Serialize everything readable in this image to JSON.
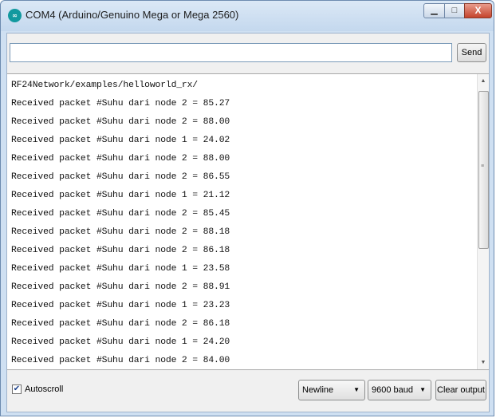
{
  "window": {
    "title": "COM4 (Arduino/Genuino Mega or Mega 2560)",
    "app_icon_text": "∞",
    "minimize_symbol": "▁",
    "maximize_symbol": "□",
    "close_symbol": "X"
  },
  "input": {
    "value": "",
    "send_label": "Send"
  },
  "output": {
    "lines": [
      "RF24Network/examples/helloworld_rx/",
      "Received packet #Suhu dari node 2 = 85.27",
      "Received packet #Suhu dari node 2 = 88.00",
      "Received packet #Suhu dari node 1 = 24.02",
      "Received packet #Suhu dari node 2 = 88.00",
      "Received packet #Suhu dari node 2 = 86.55",
      "Received packet #Suhu dari node 1 = 21.12",
      "Received packet #Suhu dari node 2 = 85.45",
      "Received packet #Suhu dari node 2 = 88.18",
      "Received packet #Suhu dari node 2 = 86.18",
      "Received packet #Suhu dari node 1 = 23.58",
      "Received packet #Suhu dari node 2 = 88.91",
      "Received packet #Suhu dari node 1 = 23.23",
      "Received packet #Suhu dari node 2 = 86.18",
      "Received packet #Suhu dari node 1 = 24.20",
      "Received packet #Suhu dari node 2 = 84.00"
    ]
  },
  "footer": {
    "autoscroll_label": "Autoscroll",
    "autoscroll_checked": true,
    "line_ending": "Newline",
    "baud_rate": "9600 baud",
    "clear_label": "Clear output"
  }
}
